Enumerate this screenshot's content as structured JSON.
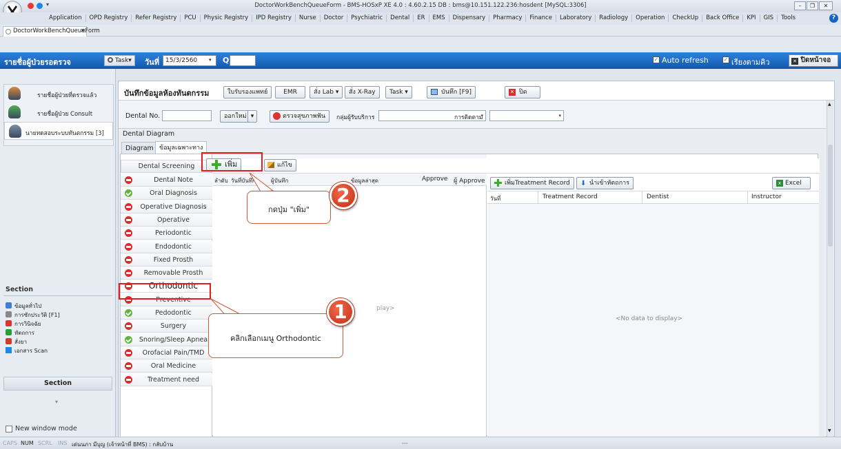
{
  "window": {
    "title": "DoctorWorkBenchQueueForm - BMS-HOSxP XE 4.0 : 4.60.2.15 DB : bms@10.151.122.236:hosdent [MySQL:3306]",
    "doc_tab": "DoctorWorkBenchQueueForm"
  },
  "menu": [
    "Application",
    "OPD Registry",
    "Refer Registry",
    "PCU",
    "Physic Registry",
    "IPD Registry",
    "Nurse",
    "Doctor",
    "Psychiatric",
    "Dental",
    "ER",
    "EMS",
    "Dispensary",
    "Pharmacy",
    "Finance",
    "Laboratory",
    "Radiology",
    "Operation",
    "CheckUp",
    "Back Office",
    "KPI",
    "GIS",
    "Tools"
  ],
  "toolbar": {
    "title": "รายชื่อผู้ป่วยรอตรวจ",
    "task": "Task▾",
    "date_label": "วันที่",
    "date_value": "15/3/2560",
    "q_label": "Q",
    "auto_refresh": "Auto refresh",
    "sort_queue": "เรียงตามคิว",
    "close_screen": "ปิดหน้าจอ"
  },
  "left_list": [
    {
      "label": "รายชื่อผู้ป่วยที่ตรวจแล้ว",
      "icon": "doctor-icon"
    },
    {
      "label": "รายชื่อผู้ป่วย Consult",
      "icon": "consult-icon"
    },
    {
      "label": "นายทดสอบระบบทันตกรรม [3]",
      "icon": "patient-icon"
    }
  ],
  "section": {
    "title": "Section",
    "items": [
      {
        "label": "ข้อมูลทั่วไป",
        "icon": "info-icon"
      },
      {
        "label": "การซักประวัติ [F1]",
        "icon": "history-icon"
      },
      {
        "label": "การวินิจฉัย",
        "icon": "diagnosis-icon"
      },
      {
        "label": "หัตถการ",
        "icon": "procedure-icon"
      },
      {
        "label": "สั่งยา",
        "icon": "medicine-icon"
      },
      {
        "label": "เอกสาร Scan",
        "icon": "scan-icon"
      }
    ],
    "button": "Section",
    "new_window": "New window mode"
  },
  "content": {
    "title": "บันทึกข้อมูลห้องทันตกรรม",
    "buttons": [
      "ใบรับรองแพทย์",
      "EMR",
      "สั่ง Lab ▾",
      "สั่ง X-Ray",
      "Task ▾",
      "บันทึก [F9]",
      "ปิด"
    ],
    "dental_no_label": "Dental No.",
    "new_btn": "ออกใหม่",
    "exam_btn": "ตรวจสุขภาพฟัน",
    "service_group_label": "กลุ่มผู้รับบริการ",
    "followup_label": "การติดตาม",
    "dental_diagram": "Dental Diagram",
    "tabs": [
      "Diagram",
      "ข้อมูลเฉพาะทาง"
    ],
    "sidebar_header": "Dental Screening",
    "sidebar": [
      {
        "label": "Dental Note",
        "status": "red"
      },
      {
        "label": "Oral Diagnosis",
        "status": "green"
      },
      {
        "label": "Operative Diagnosis",
        "status": "red"
      },
      {
        "label": "Operative",
        "status": "red"
      },
      {
        "label": "Periodontic",
        "status": "red"
      },
      {
        "label": "Endodontic",
        "status": "red"
      },
      {
        "label": "Fixed Prosth",
        "status": "red"
      },
      {
        "label": "Removable Prosth",
        "status": "red"
      },
      {
        "label": "Orthodontic",
        "status": "red"
      },
      {
        "label": "Preventive",
        "status": "red"
      },
      {
        "label": "Pedodontic",
        "status": "green"
      },
      {
        "label": "Surgery",
        "status": "red"
      },
      {
        "label": "Snoring/Sleep Apnea",
        "status": "green"
      },
      {
        "label": "Orofacial Pain/TMD",
        "status": "red"
      },
      {
        "label": "Oral Medicine",
        "status": "red"
      },
      {
        "label": "Treatment need",
        "status": "red"
      }
    ],
    "add_btn": "เพิ่ม",
    "edit_btn": "แก้ไข",
    "grid1_headers": [
      "ลำดับ",
      "วันที่บันทึก",
      "ผู้บันทึก",
      "ข้อมูลล่าสุด",
      "Approve",
      "ผู้ Approve"
    ],
    "grid1_empty": "play>",
    "add_treatment_btn": "เพิ่มTreatment Record",
    "import_btn": "นำเข้าหัตถการ",
    "excel_btn": "Excel",
    "grid2_headers": [
      "วันที่",
      "Treatment Record",
      "Dentist",
      "Instructor"
    ],
    "grid2_empty": "<No data to display>"
  },
  "annotations": {
    "step1_text": "คลิกเลือกเมนู Orthodontic",
    "step1_num": "1",
    "step2_text": "กดปุ่ม \"เพิ่ม\"",
    "step2_num": "2"
  },
  "statusbar": {
    "caps": "CAPS",
    "num": "NUM",
    "scrl": "SCRL",
    "ins": "INS",
    "user": "เด่นนภา มีบุญ (เจ้าหน้าที่ BMS) : กลับบ้าน",
    "extra": "---"
  },
  "colors": {
    "accent_blue": "#1566c0",
    "annotation_red": "#e01e1e",
    "callout_orange": "#d9472a"
  }
}
